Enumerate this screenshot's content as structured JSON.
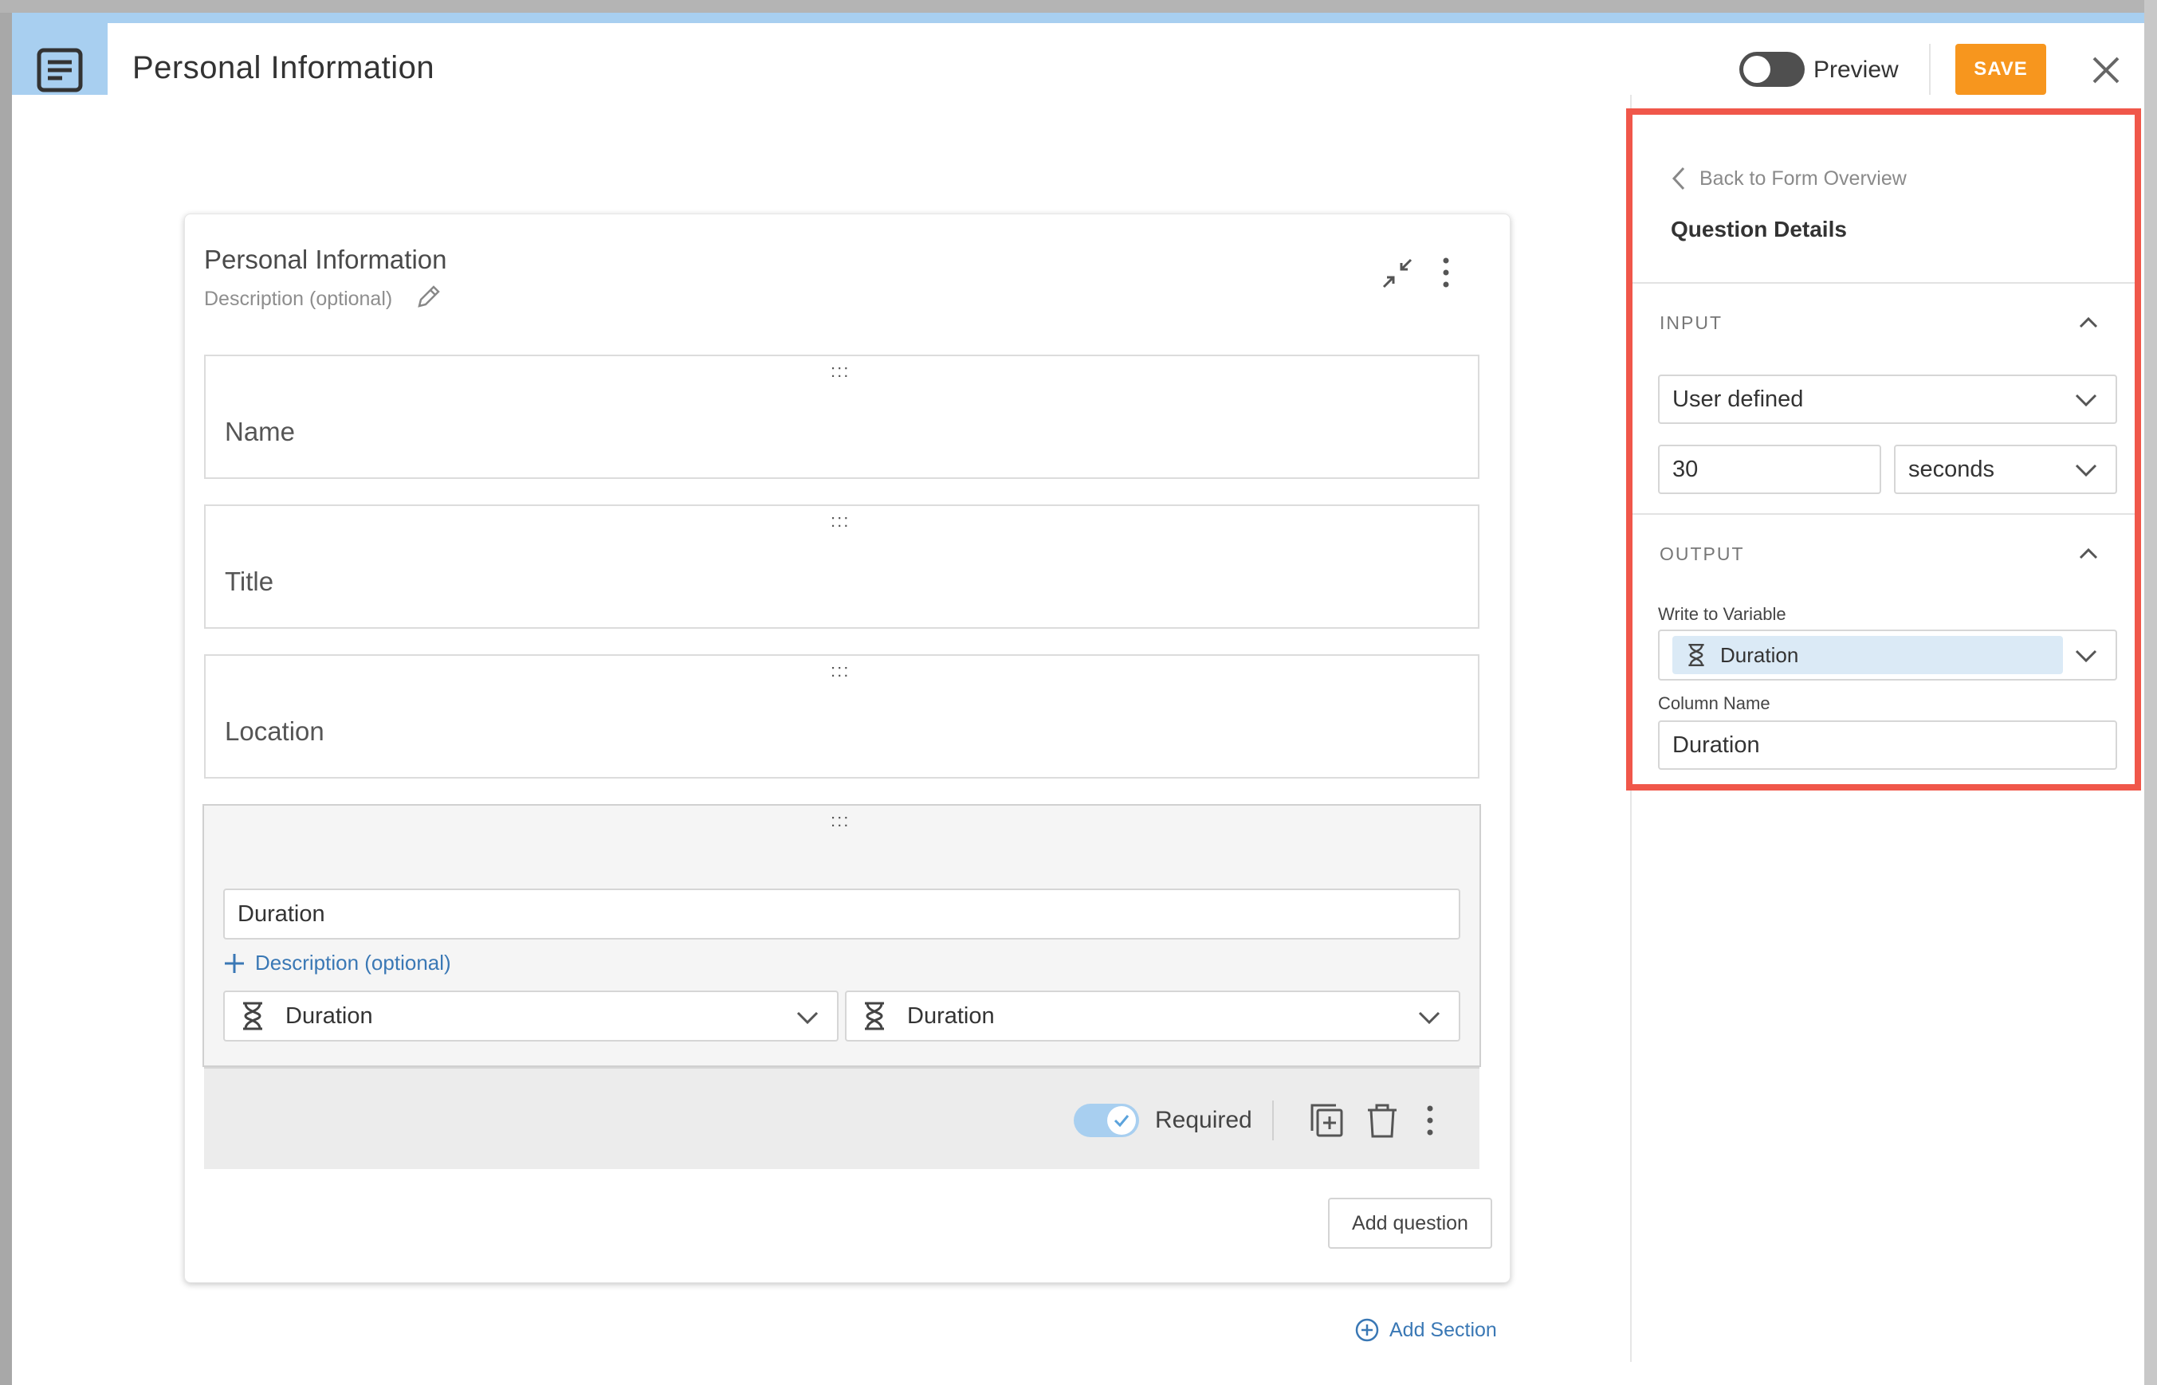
{
  "header": {
    "title": "Personal Information",
    "preview_label": "Preview",
    "save_label": "SAVE"
  },
  "section": {
    "title": "Personal Information",
    "description_placeholder": "Description (optional)"
  },
  "questions": [
    {
      "label": "Name",
      "drag_handle": ":::"
    },
    {
      "label": "Title",
      "drag_handle": ":::"
    },
    {
      "label": "Location",
      "drag_handle": ":::"
    }
  ],
  "active_question": {
    "drag_handle": ":::",
    "title_value": "Duration",
    "add_description_label": "Description (optional)",
    "type_select": "Duration",
    "variable_select": "Duration",
    "required_label": "Required"
  },
  "add_question_label": "Add question",
  "add_section_label": "Add Section",
  "panel": {
    "back_label": "Back to Form Overview",
    "title": "Question Details",
    "input_section": "INPUT",
    "input_mode": "User defined",
    "duration_value": "30",
    "duration_unit": "seconds",
    "output_section": "OUTPUT",
    "write_to_variable_label": "Write to Variable",
    "variable_chip": "Duration",
    "column_name_label": "Column Name",
    "column_name_value": "Duration"
  },
  "colors": {
    "accent_blue": "#a8cff0",
    "save_orange": "#f7961e",
    "highlight_red": "#f0574a",
    "link_blue": "#3a78b5"
  }
}
